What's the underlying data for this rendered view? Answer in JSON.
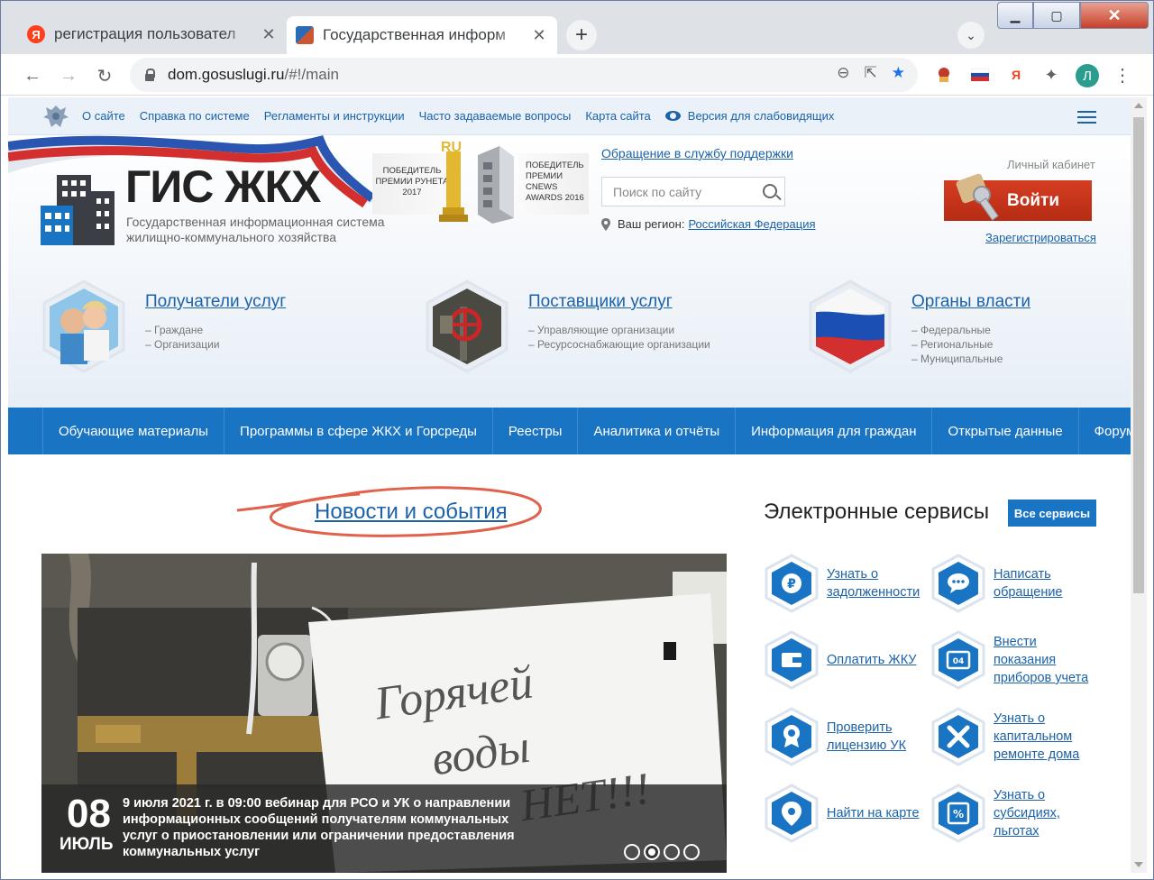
{
  "browser": {
    "tabs": [
      {
        "title": "регистрация пользовател",
        "favicon": "yandex-icon",
        "active": false
      },
      {
        "title": "Государственная информ",
        "favicon": "gis-icon",
        "active": true
      }
    ],
    "url_host": "dom.gosuslugi.ru",
    "url_path": "/#!/main",
    "profile_initial": "Л"
  },
  "topbar": {
    "links": [
      "О сайте",
      "Справка по системе",
      "Регламенты и инструкции",
      "Часто задаваемые вопросы",
      "Карта сайта"
    ],
    "accessibility": "Версия для слабовидящих"
  },
  "header": {
    "logo_title": "ГИС ЖКХ",
    "logo_subtitle": "Государственная информационная система жилищно-коммунального хозяйства",
    "award1": "ПОБЕДИТЕЛЬ ПРЕМИИ РУНЕТА 2017",
    "award2": "ПОБЕДИТЕЛЬ ПРЕМИИ CNEWS AWARDS 2016",
    "support_link": "Обращение в службу поддержки",
    "search_placeholder": "Поиск по сайту",
    "region_label": "Ваш регион:",
    "region_value": "Российская Федерация",
    "cabinet_label": "Личный кабинет",
    "login_button": "Войти",
    "register_link": "Зарегистрироваться"
  },
  "categories": [
    {
      "title": "Получатели услуг",
      "items": [
        "– Граждане",
        "– Организации"
      ]
    },
    {
      "title": "Поставщики услуг",
      "items": [
        "– Управляющие организации",
        "– Ресурсоснабжающие организации"
      ]
    },
    {
      "title": "Органы власти",
      "items": [
        "– Федеральные",
        "– Региональные",
        "– Муниципальные"
      ]
    }
  ],
  "main_nav": [
    "Обучающие материалы",
    "Программы в сфере ЖКХ и Горсреды",
    "Реестры",
    "Аналитика и отчёты",
    "Информация для граждан",
    "Открытые данные",
    "Форум"
  ],
  "news": {
    "heading": "Новости и события",
    "slide": {
      "day": "08",
      "month": "ИЮЛЬ",
      "text": "9 июля 2021 г. в 09:00 вебинар для РСО и УК о направлении информационных сообщений получателям коммунальных услуг о приостановлении или ограничении предоставления коммунальных услуг",
      "sign_text": [
        "Горячей",
        "воды",
        "НЕТ!!!"
      ]
    },
    "dots_total": 4,
    "dots_active": 2
  },
  "services": {
    "title": "Электронные сервисы",
    "all_button": "Все сервисы",
    "items": [
      {
        "label": "Узнать о задолженности",
        "icon": "ruble-icon"
      },
      {
        "label": "Написать обращение",
        "icon": "chat-icon"
      },
      {
        "label": "Оплатить ЖКУ",
        "icon": "wallet-icon"
      },
      {
        "label": "Внести показания приборов учета",
        "icon": "meter-icon"
      },
      {
        "label": "Проверить лицензию УК",
        "icon": "badge-icon"
      },
      {
        "label": "Узнать о капитальном ремонте дома",
        "icon": "tools-icon"
      },
      {
        "label": "Найти на карте",
        "icon": "map-pin-icon"
      },
      {
        "label": "Узнать о субсидиях, льготах",
        "icon": "percent-icon"
      }
    ]
  },
  "colors": {
    "primary": "#1a74c4",
    "link": "#1b62a8",
    "login": "#c7341a"
  }
}
